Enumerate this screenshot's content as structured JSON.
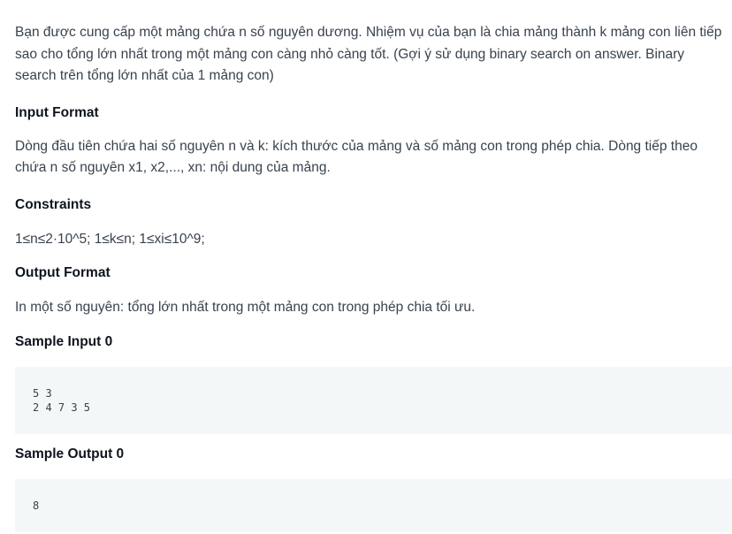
{
  "problem": {
    "statement": "Bạn được cung cấp một mảng chứa n số nguyên dương. Nhiệm vụ của bạn là chia mảng thành k mảng con liên tiếp sao cho tổng lớn nhất trong một mảng con càng nhỏ càng tốt. (Gợi ý sử dụng binary search on answer. Binary search trên tổng lớn nhất của 1 mảng con)",
    "input_format_heading": "Input Format",
    "input_format_text": "Dòng đầu tiên chứa hai số nguyên n và k: kích thước của mảng và số mảng con trong phép chia. Dòng tiếp theo chứa n số nguyên x1, x2,..., xn: nội dung của mảng.",
    "constraints_heading": "Constraints",
    "constraints_text": "1≤n≤2·10^5; 1≤k≤n; 1≤xi≤10^9;",
    "output_format_heading": "Output Format",
    "output_format_text": "In một số nguyên: tổng lớn nhất trong một mảng con trong phép chia tối ưu.",
    "sample_input_heading": "Sample Input 0",
    "sample_input_lines": [
      "5 3",
      "2 4 7 3 5"
    ],
    "sample_output_heading": "Sample Output 0",
    "sample_output_lines": [
      "8"
    ]
  }
}
